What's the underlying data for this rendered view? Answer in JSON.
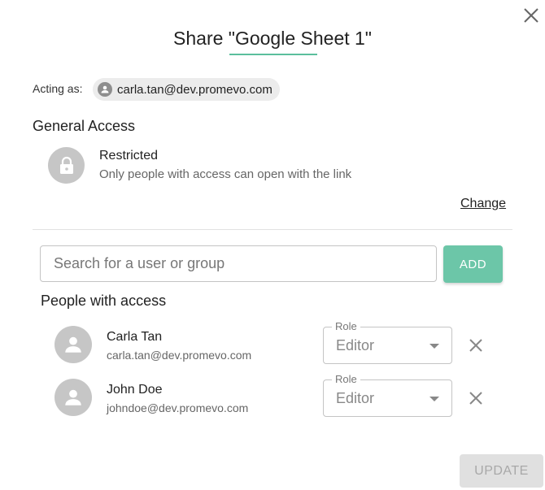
{
  "dialog": {
    "title": "Share \"Google Sheet 1\"",
    "accent_color": "#5bbf9c"
  },
  "acting_as": {
    "label": "Acting as:",
    "email": "carla.tan@dev.promevo.com"
  },
  "general_access": {
    "heading": "General Access",
    "icon": "lock-icon",
    "title": "Restricted",
    "description": "Only people with access can open with the link",
    "change_label": "Change"
  },
  "search": {
    "placeholder": "Search for a user or group",
    "value": "",
    "add_label": "ADD",
    "add_color": "#6cc6a8"
  },
  "people": {
    "heading": "People with access",
    "role_label": "Role",
    "list": [
      {
        "name": "Carla Tan",
        "email": "carla.tan@dev.promevo.com",
        "role": "Editor"
      },
      {
        "name": "John Doe",
        "email": "johndoe@dev.promevo.com",
        "role": "Editor"
      }
    ]
  },
  "footer": {
    "update_label": "UPDATE"
  }
}
